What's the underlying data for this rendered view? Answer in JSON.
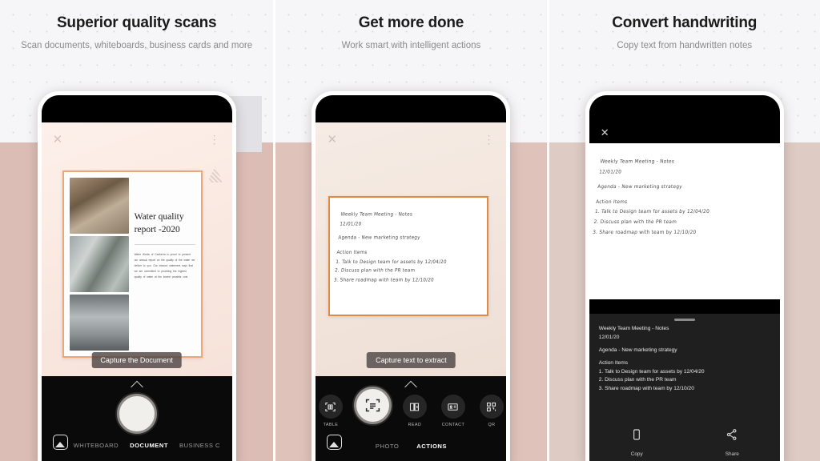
{
  "panels": [
    {
      "heading": "Superior quality scans",
      "subheading": "Scan documents, whiteboards, business cards and more",
      "tooltip": "Capture the Document",
      "document": {
        "title": "Water quality report -2020",
        "body": "Water Works of Canberra is proud to present our annual report on the quality of the water we deliver to you. Our mission statement says that we are committed to providing the highest quality of water at the lowest possible cost.",
        "border_color": "#e8a87c"
      },
      "camera": {
        "close_icon": "close-icon",
        "more_icon": "more-vertical-icon",
        "expand_icon": "chevron-up-icon",
        "shutter": "shutter-button",
        "gallery_icon": "gallery-icon",
        "modes": [
          {
            "label": "WHITEBOARD",
            "active": false
          },
          {
            "label": "DOCUMENT",
            "active": true
          },
          {
            "label": "BUSINESS C",
            "active": false
          }
        ]
      }
    },
    {
      "heading": "Get more done",
      "subheading": "Work smart with intelligent actions",
      "tooltip": "Capture text to extract",
      "whiteboard": {
        "border_color": "#e08a45",
        "lines": [
          "Weekly Team Meeting - Notes",
          "12/01/20",
          "",
          "Agenda - New marketing strategy",
          "",
          "Action Items",
          "1. Talk to Design team for assets by 12/04/20",
          "2. Discuss plan with the PR team",
          "3. Share roadmap with team by 12/10/20"
        ]
      },
      "actions": [
        {
          "label": "TABLE",
          "icon": "table-scan-icon",
          "active": false
        },
        {
          "label": "",
          "icon": "text-scan-icon",
          "active": true
        },
        {
          "label": "READ",
          "icon": "read-aloud-icon",
          "active": false
        },
        {
          "label": "CONTACT",
          "icon": "business-card-icon",
          "active": false
        },
        {
          "label": "QR",
          "icon": "qr-code-icon",
          "active": false
        }
      ],
      "tabs": [
        {
          "label": "PHOTO",
          "active": false
        },
        {
          "label": "ACTIONS",
          "active": true
        }
      ],
      "gallery_icon": "gallery-icon",
      "expand_icon": "chevron-up-icon"
    },
    {
      "heading": "Convert handwriting",
      "subheading": "Copy text from handwritten notes",
      "close_icon": "close-icon",
      "scan_lines": [
        "Weekly Team Meeting - Notes",
        "12/01/20",
        "",
        "Agenda - New marketing strategy",
        "",
        "Action Items",
        "1. Talk to Design team for assets by 12/04/20",
        "2. Discuss plan with the PR team",
        "3. Share roadmap with team by 12/10/20"
      ],
      "extracted_lines": [
        "Weekly Team Meeting - Notes",
        "12/01/20",
        "",
        "Agenda - New marketing strategy",
        "",
        "Action Items",
        "1. Talk to Design team for assets by 12/04/20",
        "2. Discuss plan with the PR team",
        "3. Share roadmap with team by 12/10/20"
      ],
      "sheet_actions": [
        {
          "label": "Copy",
          "icon": "copy-icon"
        },
        {
          "label": "Share",
          "icon": "share-icon"
        }
      ]
    }
  ],
  "colors": {
    "background_top": "#f6f6f8",
    "background_bottom": "#dcbdb5",
    "accent_orange": "#e08a45",
    "phone_body": "#ffffff",
    "screen_dark": "#0a0a0a"
  }
}
